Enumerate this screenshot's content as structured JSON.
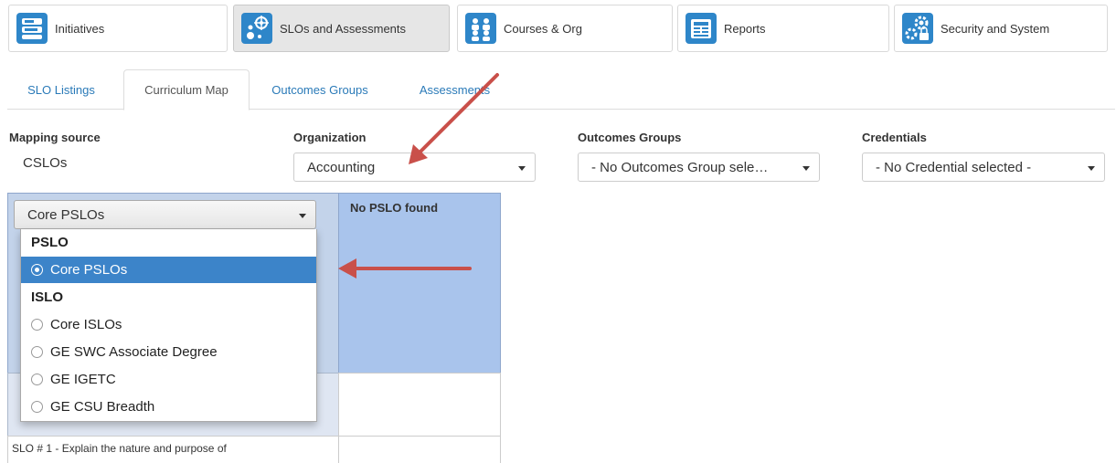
{
  "nav": {
    "tabs": [
      {
        "label": "Initiatives",
        "icon": "initiatives-icon"
      },
      {
        "label": "SLOs and Assessments",
        "icon": "slo-target-icon"
      },
      {
        "label": "Courses & Org",
        "icon": "people-icon"
      },
      {
        "label": "Reports",
        "icon": "report-icon"
      },
      {
        "label": "Security and System",
        "icon": "gear-lock-icon"
      }
    ],
    "active": "SLOs and Assessments"
  },
  "subtabs": {
    "items": [
      "SLO Listings",
      "Curriculum Map",
      "Outcomes Groups",
      "Assessments"
    ],
    "active": "Curriculum Map"
  },
  "filters": {
    "mapping_source_label": "Mapping source",
    "mapping_source_value": "CSLOs",
    "organization_label": "Organization",
    "organization_value": "Accounting",
    "outcomes_groups_label": "Outcomes Groups",
    "outcomes_groups_value": "- No Outcomes Group sele…",
    "credentials_label": "Credentials",
    "credentials_value": "- No Credential selected -"
  },
  "grid": {
    "pslo_select_value": "Core PSLOs",
    "no_pslo_text": "No PSLO found",
    "row_text": "SLO # 1 - Explain the nature and purpose of"
  },
  "dropdown": {
    "groups": [
      {
        "label": "PSLO",
        "items": [
          "Core PSLOs"
        ]
      },
      {
        "label": "ISLO",
        "items": [
          "Core ISLOs",
          "GE SWC Associate Degree",
          "GE IGETC",
          "GE CSU Breadth"
        ]
      }
    ],
    "selected": "Core PSLOs"
  },
  "colors": {
    "accent": "#2e86c9",
    "selected": "#3c84c9",
    "header_blue": "#a9c4ec",
    "annotation_arrow": "#c9504a"
  }
}
